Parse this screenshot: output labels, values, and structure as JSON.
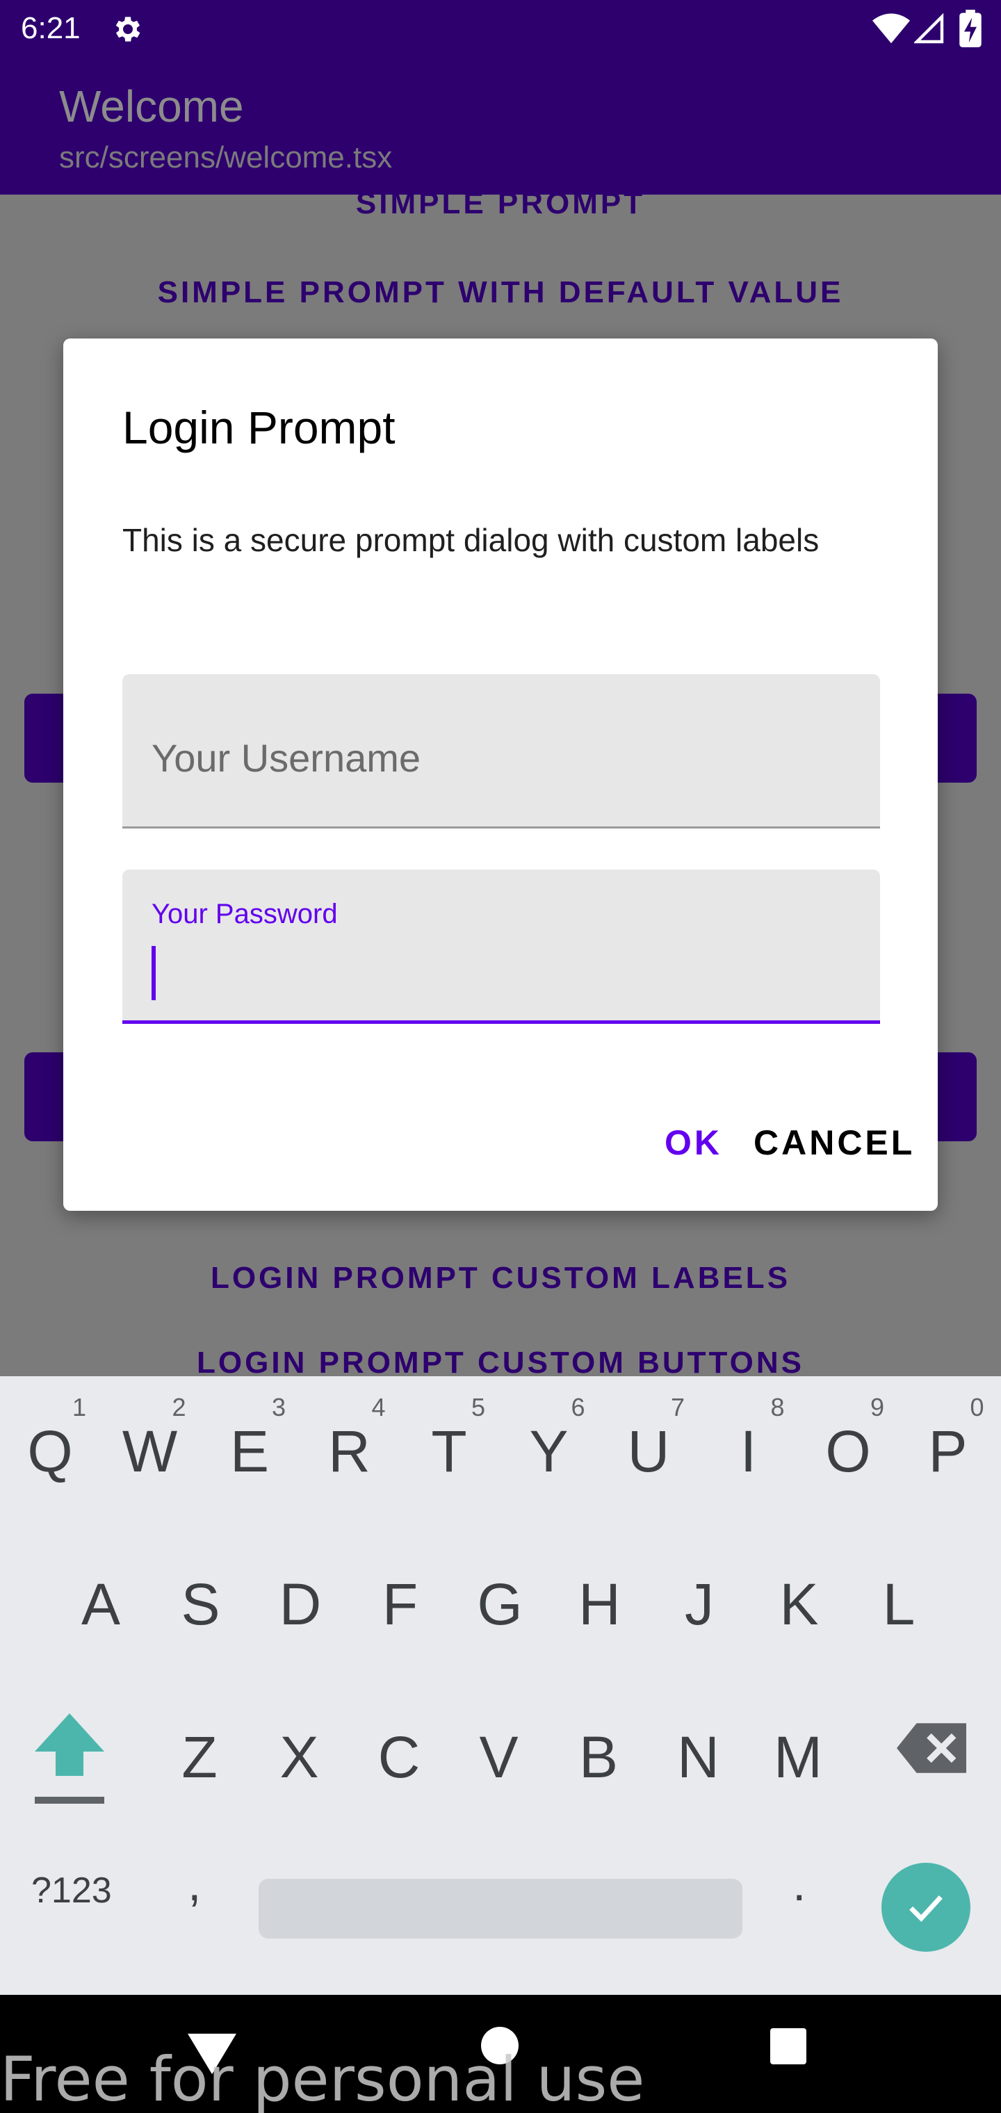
{
  "status_bar": {
    "time": "6:21",
    "icons": [
      "gear-icon",
      "wifi-icon",
      "signal-icon",
      "battery-charging-icon"
    ]
  },
  "app_bar": {
    "title": "Welcome",
    "subtitle": "src/screens/welcome.tsx"
  },
  "background_list": {
    "items": [
      "SIMPLE PROMPT",
      "SIMPLE PROMPT WITH DEFAULT VALUE",
      "LOGIN PROMPT CUSTOM LABELS",
      "LOGIN PROMPT CUSTOM BUTTONS"
    ]
  },
  "dialog": {
    "title": "Login Prompt",
    "message": "This is a secure prompt dialog with custom labels",
    "username_placeholder": "Your Username",
    "password_label": "Your Password",
    "password_value": "",
    "ok_label": "OK",
    "cancel_label": "CANCEL"
  },
  "keyboard": {
    "row1": [
      {
        "letter": "Q",
        "num": "1"
      },
      {
        "letter": "W",
        "num": "2"
      },
      {
        "letter": "E",
        "num": "3"
      },
      {
        "letter": "R",
        "num": "4"
      },
      {
        "letter": "T",
        "num": "5"
      },
      {
        "letter": "Y",
        "num": "6"
      },
      {
        "letter": "U",
        "num": "7"
      },
      {
        "letter": "I",
        "num": "8"
      },
      {
        "letter": "O",
        "num": "9"
      },
      {
        "letter": "P",
        "num": "0"
      }
    ],
    "row2": [
      "A",
      "S",
      "D",
      "F",
      "G",
      "H",
      "J",
      "K",
      "L"
    ],
    "row3": [
      "Z",
      "X",
      "C",
      "V",
      "B",
      "N",
      "M"
    ],
    "symbols_label": "?123",
    "comma": ",",
    "period": "."
  },
  "watermark": "Free for personal use",
  "colors": {
    "primary": "#2d006e",
    "accent": "#6200ee",
    "enter_key": "#4db6ac"
  }
}
